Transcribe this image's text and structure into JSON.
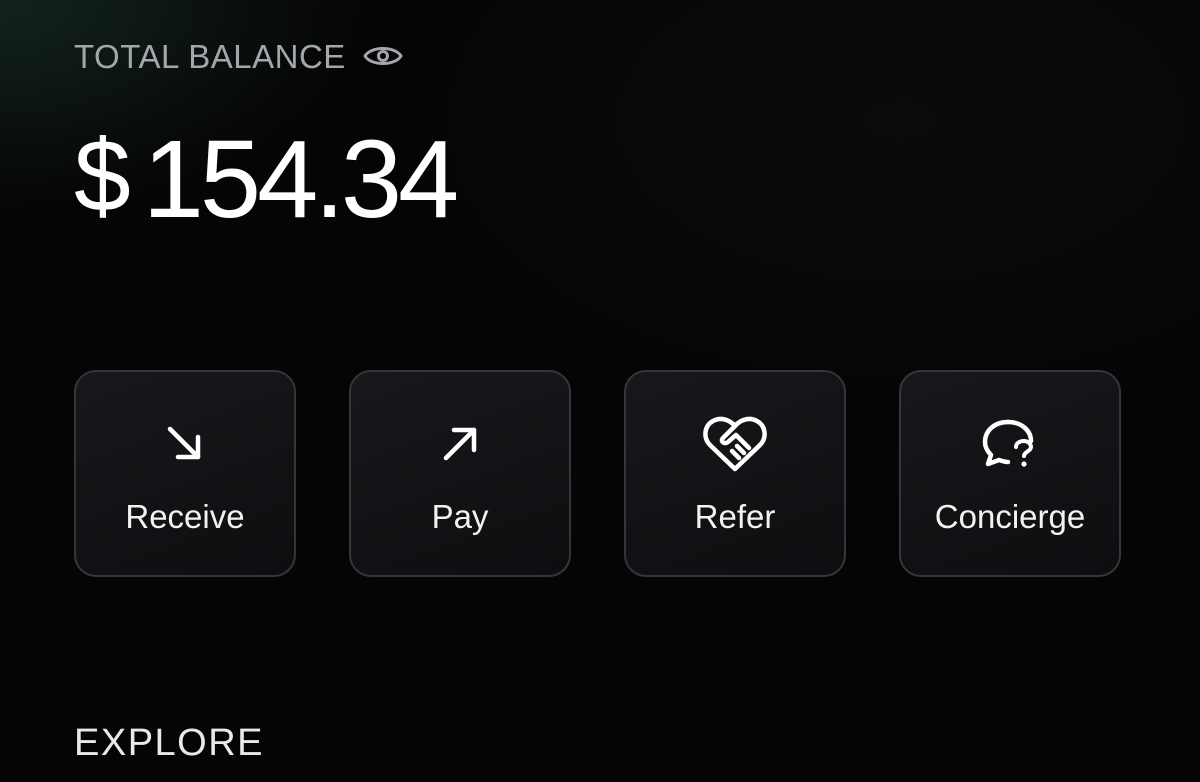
{
  "balance": {
    "label": "TOTAL BALANCE",
    "visibility_icon": "eye-icon",
    "currency_symbol": "$",
    "amount": "154.34"
  },
  "actions": [
    {
      "label": "Receive",
      "icon": "arrow-down-right-icon"
    },
    {
      "label": "Pay",
      "icon": "arrow-up-right-icon"
    },
    {
      "label": "Refer",
      "icon": "heart-handshake-icon"
    },
    {
      "label": "Concierge",
      "icon": "chat-question-icon"
    }
  ],
  "explore": {
    "label": "EXPLORE"
  },
  "colors": {
    "background": "#050505",
    "label_gray": "#a3a6ab",
    "card_border": "#34363b",
    "text": "#ffffff"
  }
}
